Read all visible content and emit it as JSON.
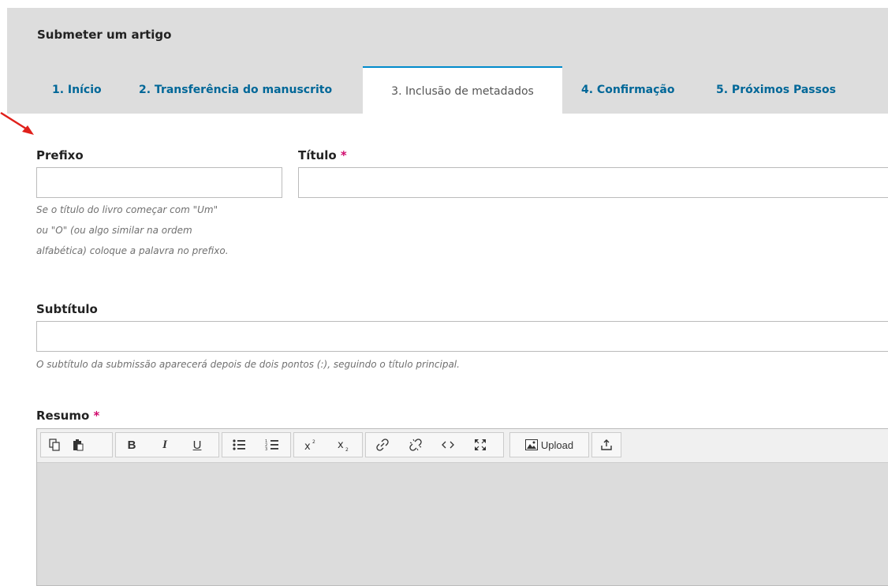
{
  "header": {
    "title": "Submeter um artigo",
    "tabs": [
      {
        "label": "1. Início"
      },
      {
        "label": "2. Transferência do manuscrito"
      },
      {
        "label": "3. Inclusão de metadados"
      },
      {
        "label": "4. Confirmação"
      },
      {
        "label": "5. Próximos Passos"
      }
    ]
  },
  "form": {
    "prefix": {
      "label": "Prefixo",
      "value": "",
      "help_lines": [
        "Se o título do livro começar com \"Um\"",
        "ou \"O\" (ou algo similar na ordem",
        "alfabética) coloque a palavra no prefixo."
      ]
    },
    "title": {
      "label": "Título",
      "required_mark": "*",
      "value": ""
    },
    "subtitle": {
      "label": "Subtítulo",
      "value": "",
      "help": "O subtítulo da submissão aparecerá depois de dois pontos (:), seguindo o título principal."
    },
    "abstract": {
      "label": "Resumo",
      "required_mark": "*",
      "toolbar": {
        "bold": "B",
        "italic": "I",
        "underline": "U",
        "upload_label": "Upload"
      }
    }
  },
  "colors": {
    "tab_link": "#006798",
    "active_tab_border": "#008acb",
    "required": "#d00a6c",
    "annotation_arrow": "#e0201b"
  }
}
